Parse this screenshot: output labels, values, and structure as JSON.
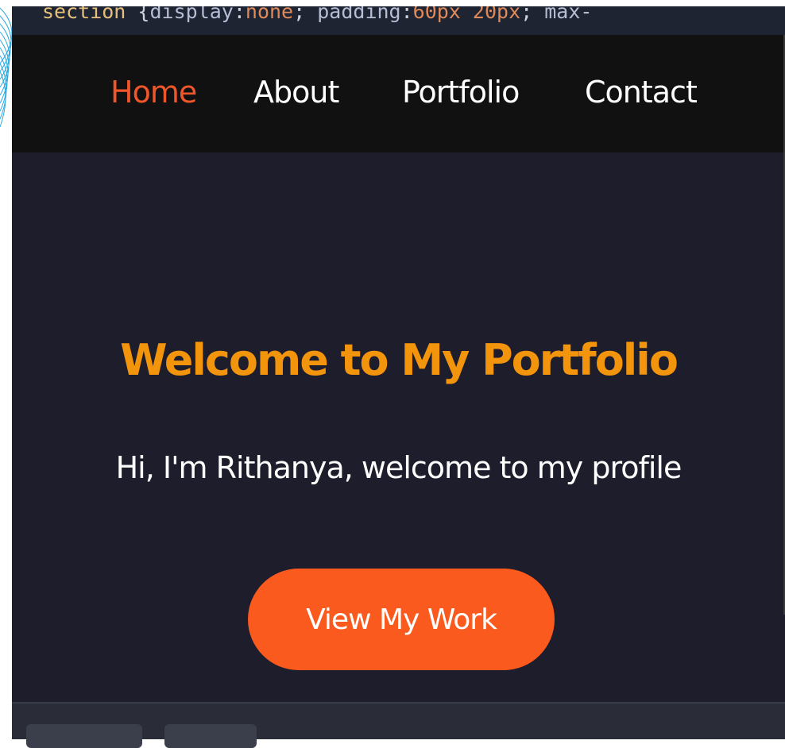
{
  "code_editor": {
    "selector": "section",
    "brace": "{",
    "prop1": "display",
    "val1": "none",
    "prop2": "padding",
    "val2": "60px 20px",
    "prop3": "max-"
  },
  "nav": {
    "links": [
      {
        "label": "Home",
        "active": true
      },
      {
        "label": "About",
        "active": false
      },
      {
        "label": "Portfolio",
        "active": false
      },
      {
        "label": "Contact",
        "active": false
      }
    ]
  },
  "hero": {
    "title": "Welcome to My Portfolio",
    "subtitle": "Hi, I'm Rithanya, welcome to my profile",
    "cta_label": "View My Work"
  },
  "colors": {
    "nav_bg": "#111111",
    "hero_bg": "#1e1d2c",
    "accent_orange": "#fb5a1f",
    "title_amber": "#f3940d",
    "active_link": "#f1562a"
  }
}
